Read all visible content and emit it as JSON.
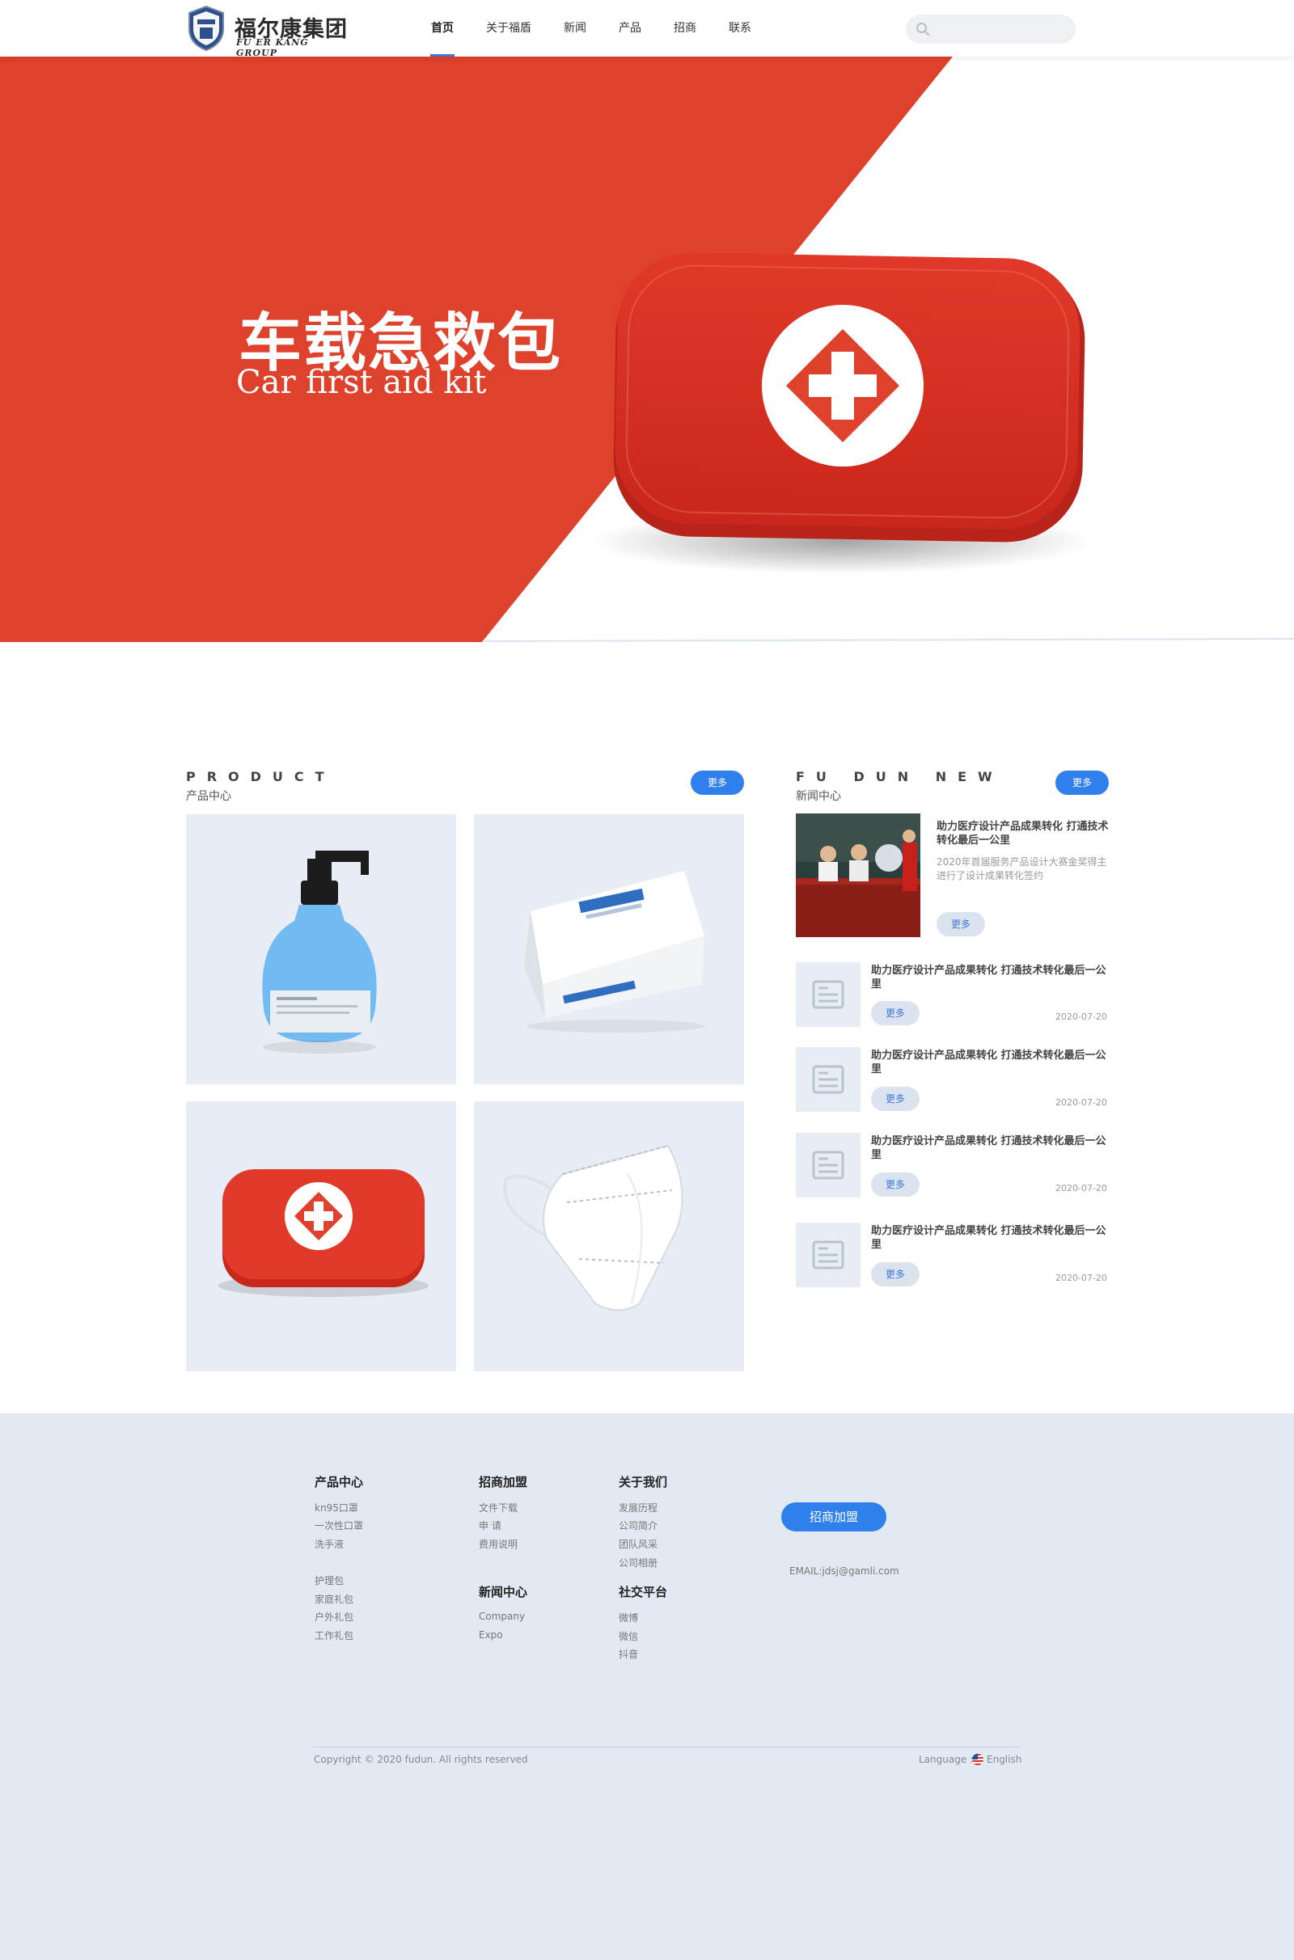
{
  "header": {
    "logo": {
      "cn": "福尔康集团",
      "en": "FU ER KANG GROUP"
    },
    "nav": [
      {
        "label": "首页"
      },
      {
        "label": "关于福盾"
      },
      {
        "label": "新闻"
      },
      {
        "label": "产品"
      },
      {
        "label": "招商"
      },
      {
        "label": "联系"
      }
    ],
    "active_nav": "首页",
    "search": {
      "placeholder": ""
    }
  },
  "hero": {
    "title_cn": "车载急救包",
    "title_en": "Car first aid kit",
    "accent_color": "#de412c"
  },
  "products": {
    "title_en": "PRODUCT",
    "title_cn": "产品中心",
    "more_label": "更多",
    "items": [
      {
        "name": "hand-sanitizer"
      },
      {
        "name": "mask-box"
      },
      {
        "name": "first-aid-kit"
      },
      {
        "name": "kn95-mask"
      }
    ]
  },
  "news": {
    "title_en": "FU DUN NEW",
    "title_cn": "新闻中心",
    "more_label": "更多",
    "featured": {
      "title": "助力医疗设计产品成果转化 打通技术转化最后一公里",
      "desc": "2020年首届服务产品设计大赛金奖得主进行了设计成果转化签约",
      "button": "更多"
    },
    "items": [
      {
        "title": "助力医疗设计产品成果转化 打通技术转化最后一公里",
        "button": "更多",
        "date": "2020-07-20"
      },
      {
        "title": "助力医疗设计产品成果转化 打通技术转化最后一公里",
        "button": "更多",
        "date": "2020-07-20"
      },
      {
        "title": "助力医疗设计产品成果转化 打通技术转化最后一公里",
        "button": "更多",
        "date": "2020-07-20"
      },
      {
        "title": "助力医疗设计产品成果转化 打通技术转化最后一公里",
        "button": "更多",
        "date": "2020-07-20"
      }
    ]
  },
  "footer": {
    "products": {
      "heading": "产品中心",
      "links": [
        "kn95口罩",
        "一次性口罩",
        "洗手液",
        "护理包",
        "家庭礼包",
        "户外礼包",
        "工作礼包"
      ]
    },
    "join": {
      "heading": "招商加盟",
      "links": [
        "文件下载",
        "申 请",
        "费用说明"
      ]
    },
    "news": {
      "heading": "新闻中心",
      "links": [
        "Company",
        "Expo"
      ]
    },
    "about": {
      "heading": "关于我们",
      "links": [
        "发展历程",
        "公司简介",
        "团队风采",
        "公司相册"
      ]
    },
    "social": {
      "heading": "社交平台",
      "links": [
        "微博",
        "微信",
        "抖音"
      ]
    },
    "join_button": "招商加盟",
    "email": "EMAIL:jdsj@gamli.com",
    "copyright": "Copyright © 2020 fudun. All rights reserved",
    "language_label": "Language :",
    "language_value": "English"
  }
}
